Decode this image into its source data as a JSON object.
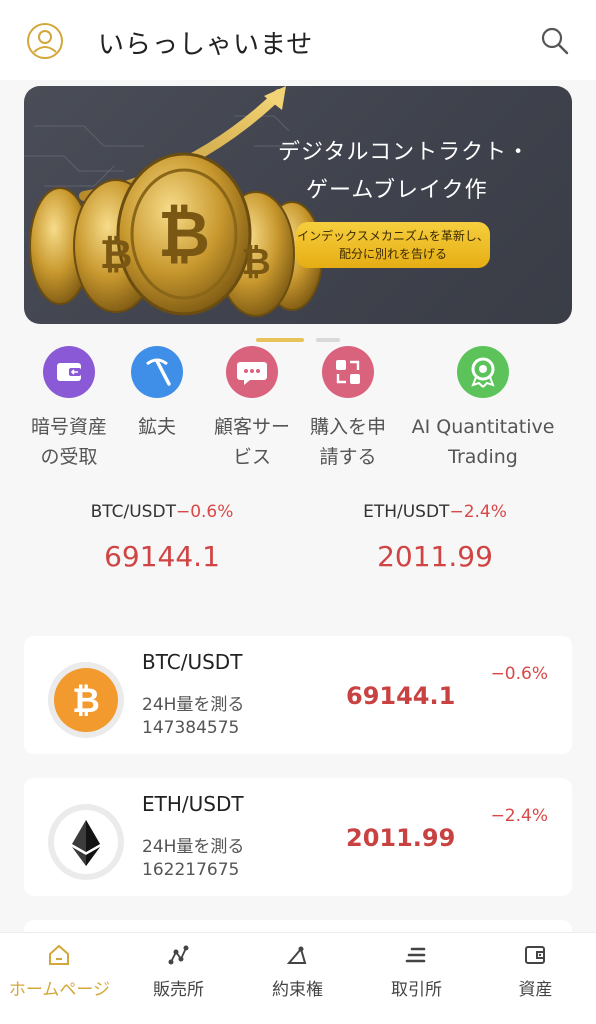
{
  "header": {
    "greeting": "いらっしゃいませ",
    "avatar_icon": "user-circle-icon",
    "search_icon": "search-icon"
  },
  "banner": {
    "title_line1": "デジタルコントラクト・",
    "title_line2": "ゲームブレイク作",
    "pill_line1": "インデックスメカニズムを革新し、",
    "pill_line2": "配分に別れを告げる",
    "active_slide": 1,
    "slide_count": 2
  },
  "quick_actions": [
    {
      "line1": "暗号資産",
      "line2": "の受取",
      "icon": "wallet-icon",
      "color": "#8a5ad6"
    },
    {
      "line1": "鉱夫",
      "line2": "",
      "icon": "pickaxe-icon",
      "color": "#3f8fe8"
    },
    {
      "line1": "顧客サー",
      "line2": "ビス",
      "icon": "chat-bubble-icon",
      "color": "#d9627d"
    },
    {
      "line1": "購入を申",
      "line2": "請する",
      "icon": "exchange-icon",
      "color": "#d9627d"
    },
    {
      "line1": "AI Quantitative",
      "line2": "Trading",
      "icon": "robot-badge-icon",
      "color": "#5cc35a"
    }
  ],
  "tickers": [
    {
      "pair": "BTC/USDT",
      "change": "−0.6%",
      "price": "69144.1"
    },
    {
      "pair": "ETH/USDT",
      "change": "−2.4%",
      "price": "2011.99"
    }
  ],
  "markets": [
    {
      "pair": "BTC/USDT",
      "volume_label": "24H量を測る",
      "volume": "147384575",
      "price": "69144.1",
      "change": "−0.6%",
      "icon": "bitcoin-icon"
    },
    {
      "pair": "ETH/USDT",
      "volume_label": "24H量を測る",
      "volume": "162217675",
      "price": "2011.99",
      "change": "−2.4%",
      "icon": "ethereum-icon"
    }
  ],
  "tabs": [
    {
      "label": "ホームページ",
      "icon": "home-icon",
      "active": true
    },
    {
      "label": "販売所",
      "icon": "nodes-icon",
      "active": false
    },
    {
      "label": "約束権",
      "icon": "triangle-icon",
      "active": false
    },
    {
      "label": "取引所",
      "icon": "list-icon",
      "active": false
    },
    {
      "label": "資産",
      "icon": "wallet-outline-icon",
      "active": false
    }
  ],
  "colors": {
    "accent_gold": "#d4a73a",
    "down_red": "#d04444",
    "banner_bg": "#454852"
  }
}
